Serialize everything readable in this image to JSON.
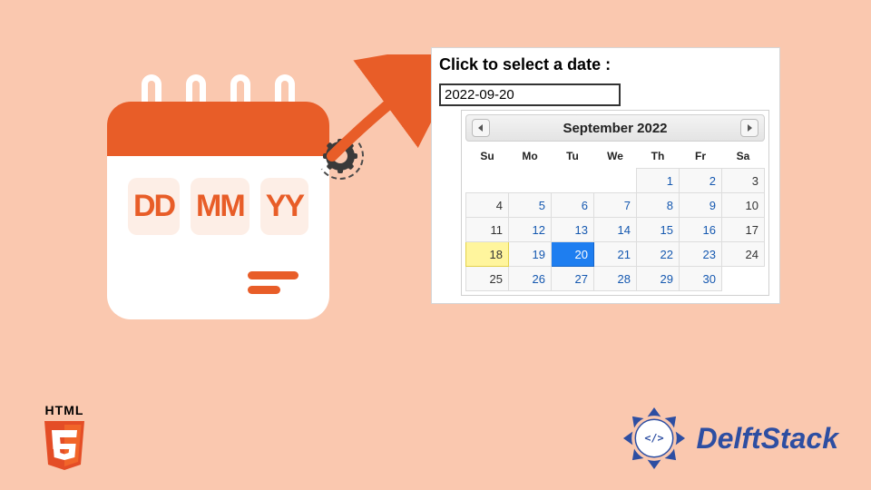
{
  "decor": {
    "dd": "DD",
    "mm": "MM",
    "yy": "YY"
  },
  "panel": {
    "title": "Click to select a date :",
    "input_value": "2022-09-20"
  },
  "picker": {
    "month_label": "September 2022",
    "weekdays": [
      "Su",
      "Mo",
      "Tu",
      "We",
      "Th",
      "Fr",
      "Sa"
    ],
    "weeks": [
      [
        null,
        null,
        null,
        null,
        1,
        2,
        3
      ],
      [
        4,
        5,
        6,
        7,
        8,
        9,
        10
      ],
      [
        11,
        12,
        13,
        14,
        15,
        16,
        17
      ],
      [
        18,
        19,
        20,
        21,
        22,
        23,
        24
      ],
      [
        25,
        26,
        27,
        28,
        29,
        30,
        null
      ]
    ],
    "today": 18,
    "selected": 20
  },
  "footer": {
    "html5_label": "HTML",
    "brand": "DelftStack"
  }
}
